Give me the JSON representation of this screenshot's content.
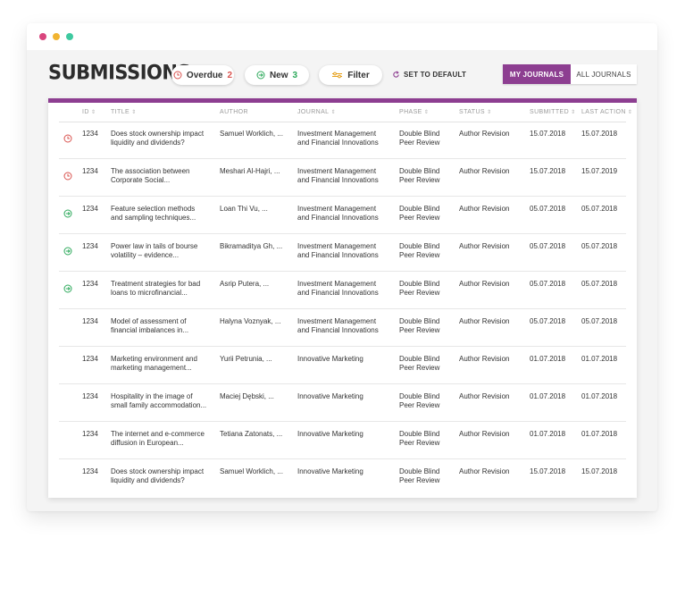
{
  "page": {
    "title": "SUBMISSIONS"
  },
  "toolbar": {
    "overdue_label": "Overdue",
    "overdue_count": "2",
    "new_label": "New",
    "new_count": "3",
    "filter_label": "Filter",
    "set_default_label": "SET TO DEFAULT"
  },
  "tabs": [
    {
      "label": "MY JOURNALS",
      "active": true
    },
    {
      "label": "ALL JOURNALS",
      "active": false
    }
  ],
  "colors": {
    "accent": "#8d3e91",
    "overdue": "#d9534f",
    "new": "#2eaa5c"
  },
  "table": {
    "columns": [
      "ID",
      "TITLE",
      "AUTHOR",
      "JOURNAL",
      "PHASE",
      "STATUS",
      "SUBMITTED",
      "LAST ACTION"
    ],
    "rows": [
      {
        "icon": "overdue",
        "id": "1234",
        "title1": "Does stock ownership impact",
        "title2": "liquidity and dividends?",
        "author": "Samuel Worklich, ...",
        "journal1": "Investment Management",
        "journal2": "and Financial Innovations",
        "phase1": "Double Blind",
        "phase2": "Peer Review",
        "status": "Author Revision",
        "submitted": "15.07.2018",
        "last": "15.07.2018"
      },
      {
        "icon": "overdue",
        "id": "1234",
        "title1": "The association between",
        "title2": "Corporate Social...",
        "author": "Meshari Al-Hajri, ...",
        "journal1": "Investment Management",
        "journal2": "and Financial Innovations",
        "phase1": "Double Blind",
        "phase2": "Peer Review",
        "status": "Author Revision",
        "submitted": "15.07.2018",
        "last": "15.07.2019"
      },
      {
        "icon": "new",
        "id": "1234",
        "title1": "Feature selection methods",
        "title2": "and sampling techniques...",
        "author": "Loan Thi Vu, ...",
        "journal1": "Investment Management",
        "journal2": "and Financial Innovations",
        "phase1": "Double Blind",
        "phase2": "Peer Review",
        "status": "Author Revision",
        "submitted": "05.07.2018",
        "last": "05.07.2018"
      },
      {
        "icon": "new",
        "id": "1234",
        "title1": "Power law in tails of bourse",
        "title2": "volatility – evidence...",
        "author": "Bikramaditya Gh, ...",
        "journal1": "Investment Management",
        "journal2": "and Financial Innovations",
        "phase1": "Double Blind",
        "phase2": "Peer Review",
        "status": "Author Revision",
        "submitted": "05.07.2018",
        "last": "05.07.2018"
      },
      {
        "icon": "new",
        "id": "1234",
        "title1": "Treatment strategies for bad",
        "title2": "loans to microfinancial...",
        "author": "Asrip Putera, ...",
        "journal1": "Investment Management",
        "journal2": "and Financial Innovations",
        "phase1": "Double Blind",
        "phase2": "Peer Review",
        "status": "Author Revision",
        "submitted": "05.07.2018",
        "last": "05.07.2018"
      },
      {
        "icon": "none",
        "id": "1234",
        "title1": "Model of assessment of",
        "title2": "financial imbalances in...",
        "author": "Halyna Voznyak, ...",
        "journal1": "Investment Management",
        "journal2": "and Financial Innovations",
        "phase1": "Double Blind",
        "phase2": "Peer Review",
        "status": "Author Revision",
        "submitted": "05.07.2018",
        "last": "05.07.2018"
      },
      {
        "icon": "none",
        "id": "1234",
        "title1": "Marketing environment and",
        "title2": "marketing management...",
        "author": "Yurii Petrunia, ...",
        "journal1": "Innovative Marketing",
        "journal2": "",
        "phase1": "Double Blind",
        "phase2": "Peer Review",
        "status": "Author Revision",
        "submitted": "01.07.2018",
        "last": "01.07.2018"
      },
      {
        "icon": "none",
        "id": "1234",
        "title1": "Hospitality in the image of",
        "title2": "small family accommodation...",
        "author": "Maciej Dębski, ...",
        "journal1": "Innovative Marketing",
        "journal2": "",
        "phase1": "Double Blind",
        "phase2": "Peer Review",
        "status": "Author Revision",
        "submitted": "01.07.2018",
        "last": "01.07.2018"
      },
      {
        "icon": "none",
        "id": "1234",
        "title1": "The internet and e-commerce",
        "title2": "diffusion in European...",
        "author": "Tetiana Zatonats, ...",
        "journal1": "Innovative Marketing",
        "journal2": "",
        "phase1": "Double Blind",
        "phase2": "Peer Review",
        "status": "Author Revision",
        "submitted": "01.07.2018",
        "last": "01.07.2018"
      },
      {
        "icon": "none",
        "id": "1234",
        "title1": "Does stock ownership impact",
        "title2": "liquidity and dividends?",
        "author": "Samuel Worklich, ...",
        "journal1": "Innovative Marketing",
        "journal2": "",
        "phase1": "Double Blind",
        "phase2": "Peer Review",
        "status": "Author Revision",
        "submitted": "15.07.2018",
        "last": "15.07.2018"
      }
    ]
  }
}
